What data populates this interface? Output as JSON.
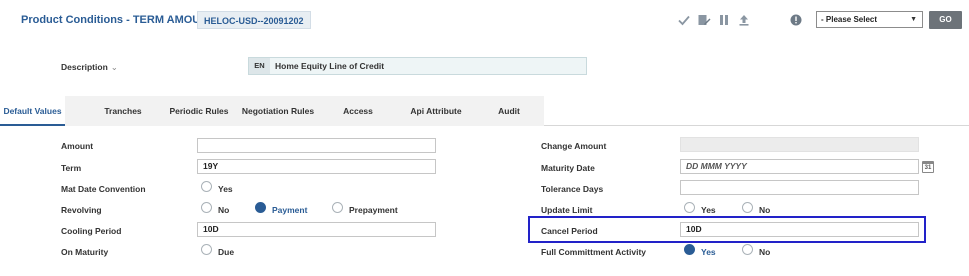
{
  "header": {
    "title": "Product Conditions - TERM AMOUNT",
    "code": "HELOC-USD--20091202",
    "toolbar_icons": [
      "check-icon",
      "edit-icon",
      "pause-icon",
      "upload-icon",
      "info-icon"
    ],
    "select_value": "- Please Select",
    "go_label": "GO"
  },
  "description": {
    "label": "Description",
    "chevron": "⌄",
    "lang": "EN",
    "value": "Home Equity Line of Credit"
  },
  "tabs": [
    {
      "label": "Default Values",
      "active": true
    },
    {
      "label": "Tranches",
      "active": false
    },
    {
      "label": "Periodic Rules",
      "active": false
    },
    {
      "label": "Negotiation Rules",
      "active": false
    },
    {
      "label": "Access",
      "active": false
    },
    {
      "label": "Api Attribute",
      "active": false
    },
    {
      "label": "Audit",
      "active": false
    }
  ],
  "left": {
    "amount": {
      "label": "Amount",
      "value": ""
    },
    "term": {
      "label": "Term",
      "value": "19Y"
    },
    "mat_date_convention": {
      "label": "Mat Date Convention",
      "option": "Yes"
    },
    "revolving": {
      "label": "Revolving",
      "options": [
        "No",
        "Payment",
        "Prepayment"
      ],
      "selected": "Payment"
    },
    "cooling_period": {
      "label": "Cooling Period",
      "value": "10D"
    },
    "on_maturity": {
      "label": "On Maturity",
      "option": "Due"
    }
  },
  "right": {
    "change_amount": {
      "label": "Change Amount",
      "value": ""
    },
    "maturity_date": {
      "label": "Maturity Date",
      "placeholder": "DD MMM YYYY",
      "calendar_text": "31"
    },
    "tolerance_days": {
      "label": "Tolerance Days",
      "value": ""
    },
    "update_limit": {
      "label": "Update Limit",
      "options": [
        "Yes",
        "No"
      ],
      "selected": ""
    },
    "cancel_period": {
      "label": "Cancel Period",
      "value": "10D"
    },
    "full_commitment": {
      "label": "Full Committment Activity",
      "options": [
        "Yes",
        "No"
      ],
      "selected": "Yes"
    }
  },
  "colors": {
    "accent": "#2a5c95",
    "highlight": "#2222c8"
  }
}
